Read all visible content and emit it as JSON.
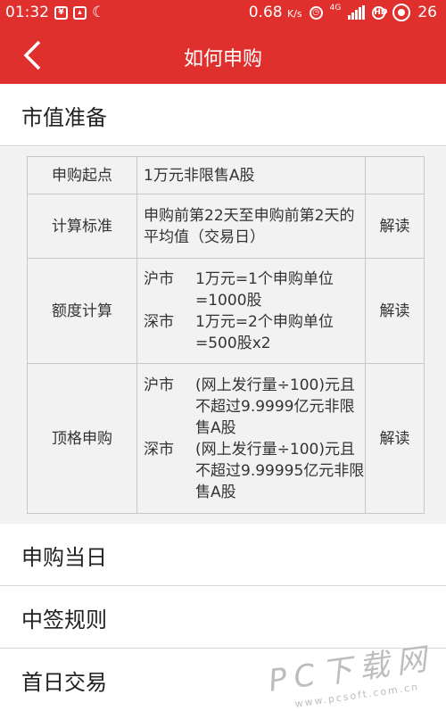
{
  "status_bar": {
    "time": "01:32",
    "speed": "0.68",
    "speed_unit": "K/s",
    "network": "4G",
    "battery": "26"
  },
  "nav": {
    "title": "如何申购"
  },
  "sections": {
    "market_value": "市值准备",
    "purchase_day": "申购当日",
    "lottery_rules": "中签规则",
    "first_day": "首日交易"
  },
  "table": {
    "rows": [
      {
        "label": "申购起点",
        "content": "1万元非限售A股",
        "action": ""
      },
      {
        "label": "计算标准",
        "content": "申购前第22天至申购前第2天的平均值（交易日）",
        "action": "解读"
      },
      {
        "label": "额度计算",
        "sh_label": "沪市",
        "sh_text": "1万元=1个申购单位=1000股",
        "sz_label": "深市",
        "sz_text": "1万元=2个申购单位=500股x2",
        "action": "解读"
      },
      {
        "label": "顶格申购",
        "sh_label": "沪市",
        "sh_text": "(网上发行量÷100)元且不超过9.9999亿元非限售A股",
        "sz_label": "深市",
        "sz_text": "(网上发行量÷100)元且不超过9.99995亿元非限售A股",
        "action": "解读"
      }
    ]
  },
  "watermark": {
    "main": "PC下载网",
    "sub": "www.pcsoft.com.cn"
  }
}
